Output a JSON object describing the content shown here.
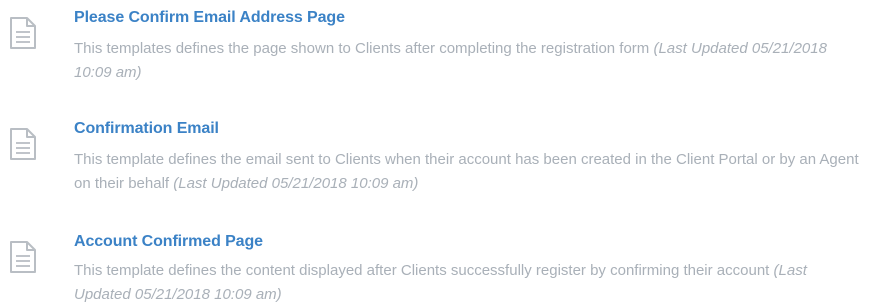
{
  "templates": [
    {
      "icon": "document-icon",
      "title": "Please Confirm Email Address Page",
      "description": "This templates defines the page shown to Clients after completing the registration form",
      "updated": "(Last Updated 05/21/2018 10:09 am)"
    },
    {
      "icon": "document-icon",
      "title": "Confirmation Email",
      "description": "This template defines the email sent to Clients when their account has been created in the Client Portal or by an Agent on their behalf",
      "updated": "(Last Updated 05/21/2018 10:09 am)"
    },
    {
      "icon": "document-icon",
      "title": "Account Confirmed Page",
      "description": "This template defines the content displayed after Clients successfully register by confirming their account",
      "updated": "(Last Updated 05/21/2018 10:09 am)"
    }
  ],
  "colors": {
    "title": "#3b82c6",
    "description": "#a9b0b8",
    "icon": "#b9bec4"
  }
}
